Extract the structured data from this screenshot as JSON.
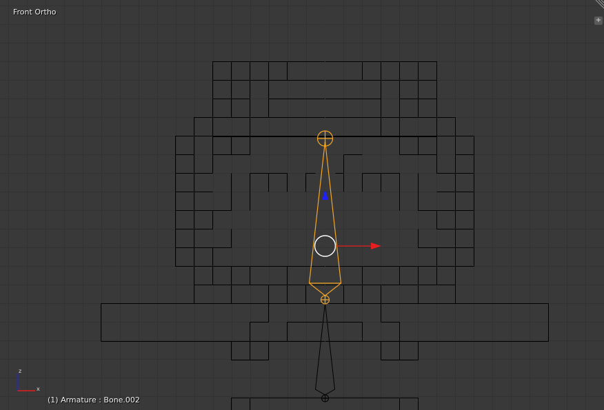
{
  "viewport": {
    "view_name": "Front Ortho",
    "active_object_info": "(1) Armature : Bone.002",
    "axis_labels": {
      "vertical": "z",
      "horizontal": "x"
    },
    "add_region_glyph": "+"
  },
  "colors": {
    "background": "#393939",
    "grid_line": "#333333",
    "wire": "#000000",
    "selected_bone": "#f5a623",
    "axis_blue": "#1f1fff",
    "axis_red": "#e41f1f",
    "manipulator_circle": "#ffffff"
  },
  "icons": [
    "corner-resize-icon",
    "plus-icon",
    "axis-gizmo-icon",
    "translate-manipulator-icon"
  ]
}
